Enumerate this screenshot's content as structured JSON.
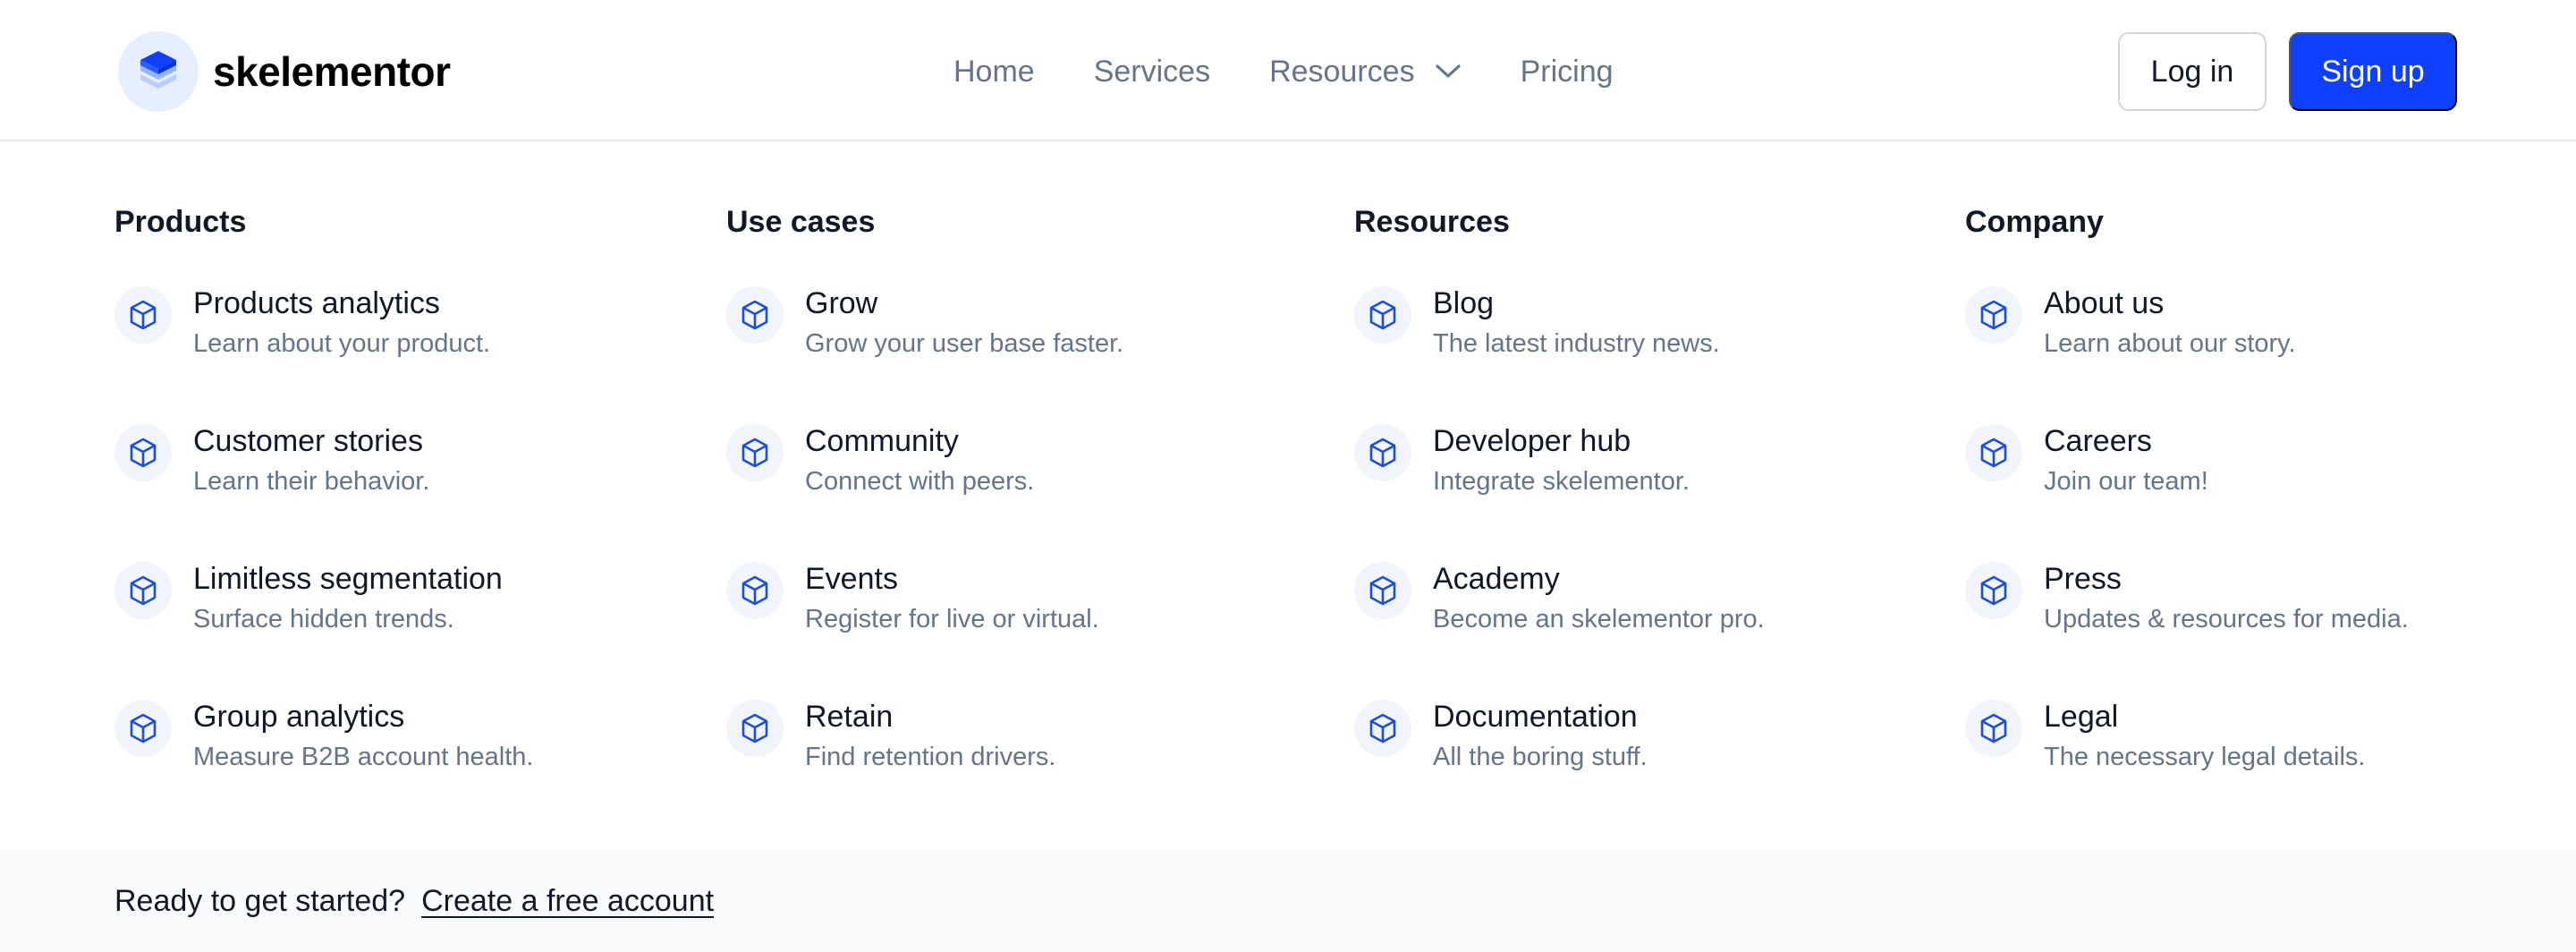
{
  "brand": {
    "name": "skelementor",
    "logo_icon": "layers-icon",
    "accent_color": "#0f3fff"
  },
  "nav": {
    "items": [
      {
        "label": "Home"
      },
      {
        "label": "Services"
      },
      {
        "label": "Resources",
        "icon": "chevron-down-icon"
      },
      {
        "label": "Pricing"
      }
    ]
  },
  "auth": {
    "login_label": "Log in",
    "signup_label": "Sign up"
  },
  "menu": {
    "item_icon": "cube-icon",
    "columns": [
      {
        "title": "Products",
        "items": [
          {
            "title": "Products analytics",
            "desc": "Learn about your product."
          },
          {
            "title": "Customer stories",
            "desc": "Learn their behavior."
          },
          {
            "title": "Limitless segmentation",
            "desc": "Surface hidden trends."
          },
          {
            "title": "Group analytics",
            "desc": "Measure B2B account health."
          }
        ]
      },
      {
        "title": "Use cases",
        "items": [
          {
            "title": "Grow",
            "desc": "Grow your user base faster."
          },
          {
            "title": "Community",
            "desc": "Connect with peers."
          },
          {
            "title": "Events",
            "desc": "Register for live or virtual."
          },
          {
            "title": "Retain",
            "desc": "Find retention drivers."
          }
        ]
      },
      {
        "title": "Resources",
        "items": [
          {
            "title": "Blog",
            "desc": "The latest industry news."
          },
          {
            "title": "Developer hub",
            "desc": "Integrate skelementor."
          },
          {
            "title": "Academy",
            "desc": "Become an skelementor pro."
          },
          {
            "title": "Documentation",
            "desc": "All the boring stuff."
          }
        ]
      },
      {
        "title": "Company",
        "items": [
          {
            "title": "About us",
            "desc": "Learn about our story."
          },
          {
            "title": "Careers",
            "desc": "Join our team!"
          },
          {
            "title": "Press",
            "desc": "Updates & resources for media."
          },
          {
            "title": "Legal",
            "desc": "The necessary legal details."
          }
        ]
      }
    ]
  },
  "cta": {
    "text": "Ready to get started?",
    "link_label": "Create a free account"
  }
}
